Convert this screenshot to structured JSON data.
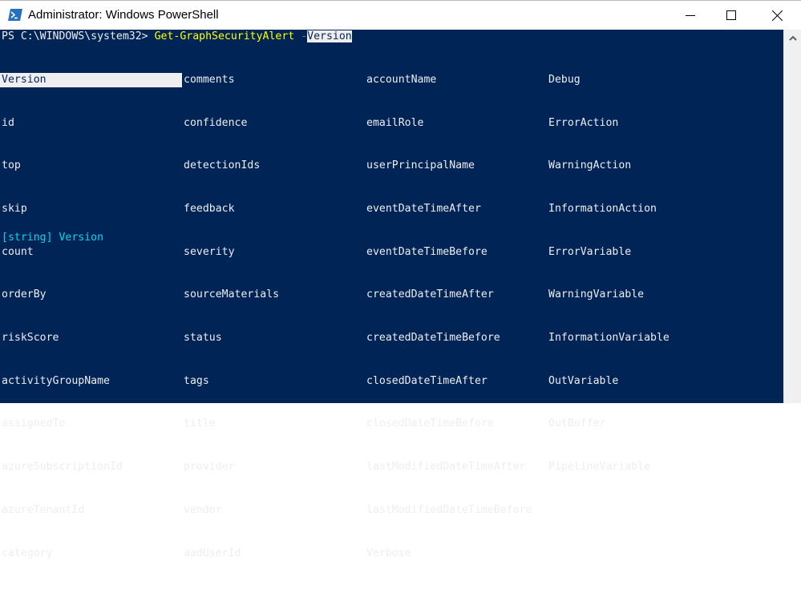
{
  "window": {
    "title": "Administrator: Windows PowerShell",
    "controls": {
      "minimize": "minimize",
      "maximize": "maximize",
      "close": "close"
    }
  },
  "console": {
    "prompt": "PS C:\\WINDOWS\\system32> ",
    "command": "Get-GraphSecurityAlert",
    "space": " ",
    "param_dash": "-",
    "param_name": "Version",
    "completion_columns": [
      [
        "Version",
        "id",
        "top",
        "skip",
        "count",
        "orderBy",
        "riskScore",
        "activityGroupName",
        "assignedTo",
        "azureSubscriptionId",
        "azureTenantId",
        "category"
      ],
      [
        "comments",
        "confidence",
        "detectionIds",
        "feedback",
        "severity",
        "sourceMaterials",
        "status",
        "tags",
        "title",
        "provider",
        "vendor",
        "aadUserId"
      ],
      [
        "accountName",
        "emailRole",
        "userPrincipalName",
        "eventDateTimeAfter",
        "eventDateTimeBefore",
        "createdDateTimeAfter",
        "createdDateTimeBefore",
        "closedDateTimeAfter",
        "closedDateTimeBefore",
        "lastModifiedDateTimeAfter",
        "lastModifiedDateTimeBefore",
        "Verbose"
      ],
      [
        "Debug",
        "ErrorAction",
        "WarningAction",
        "InformationAction",
        "ErrorVariable",
        "WarningVariable",
        "InformationVariable",
        "OutVariable",
        "OutBuffer",
        "PipelineVariable"
      ]
    ],
    "selected_item": "Version",
    "tooltip": "[string] Version"
  },
  "colors": {
    "console_bg": "#012456",
    "console_fg": "#eeedf0",
    "command": "#ffff00",
    "tooltip": "#00d7f0"
  }
}
